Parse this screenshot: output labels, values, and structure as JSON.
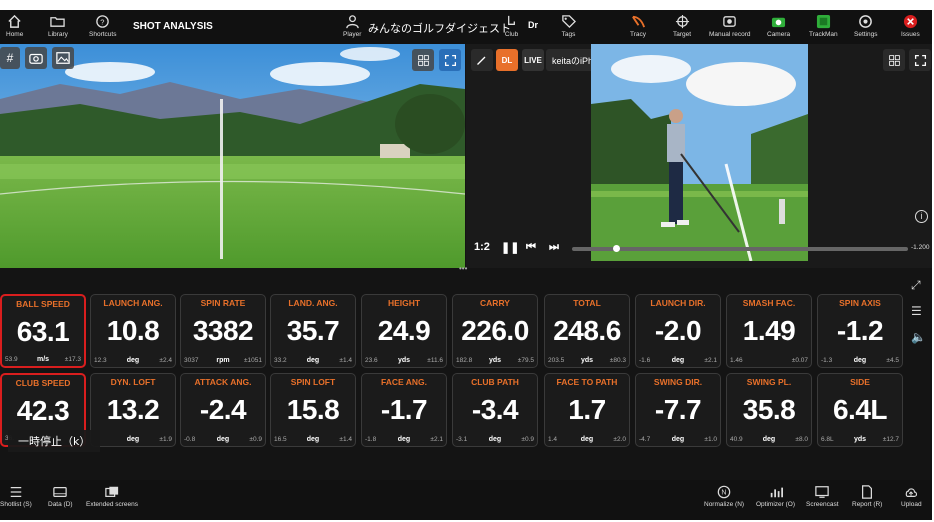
{
  "topbar": {
    "nav": [
      {
        "label": "Home",
        "icon": "home-icon"
      },
      {
        "label": "Library",
        "icon": "folder-icon"
      },
      {
        "label": "Shortcuts",
        "icon": "shortcuts-icon"
      }
    ],
    "title": "SHOT ANALYSIS",
    "player_label": "Player",
    "player_name": "みんなのゴルフダイジェスト",
    "club_label": "Club",
    "club_value": "Dr",
    "tags_label": "Tags",
    "right": [
      {
        "label": "Tracy",
        "icon": "tracy-icon"
      },
      {
        "label": "Target",
        "icon": "target-icon"
      },
      {
        "label": "Manual record",
        "icon": "manual-record-icon"
      },
      {
        "label": "Camera",
        "icon": "camera-icon"
      },
      {
        "label": "TrackMan",
        "icon": "trackman-icon"
      },
      {
        "label": "Settings",
        "icon": "settings-icon"
      },
      {
        "label": "Issues",
        "icon": "issues-icon"
      }
    ]
  },
  "video": {
    "dl_label": "DL",
    "live_label": "LIVE",
    "camera_name": "keitaのiPhone",
    "speed": "1:2",
    "time_end": "-1.200",
    "progress": 0.13
  },
  "metrics_row1": [
    {
      "label": "BALL SPEED",
      "value": "63.1",
      "min": "53.9",
      "unit": "m/s",
      "pm": "±17.3",
      "selected": true
    },
    {
      "label": "LAUNCH ANG.",
      "value": "10.8",
      "min": "12.3",
      "unit": "deg",
      "pm": "±2.4"
    },
    {
      "label": "SPIN RATE",
      "value": "3382",
      "min": "3037",
      "unit": "rpm",
      "pm": "±1051"
    },
    {
      "label": "LAND. ANG.",
      "value": "35.7",
      "min": "33.2",
      "unit": "deg",
      "pm": "±1.4"
    },
    {
      "label": "HEIGHT",
      "value": "24.9",
      "min": "23.6",
      "unit": "yds",
      "pm": "±11.6"
    },
    {
      "label": "CARRY",
      "value": "226.0",
      "min": "182.8",
      "unit": "yds",
      "pm": "±79.5"
    },
    {
      "label": "TOTAL",
      "value": "248.6",
      "min": "203.5",
      "unit": "yds",
      "pm": "±80.3"
    },
    {
      "label": "LAUNCH DIR.",
      "value": "-2.0",
      "min": "-1.6",
      "unit": "deg",
      "pm": "±2.1"
    },
    {
      "label": "SMASH FAC.",
      "value": "1.49",
      "min": "1.46",
      "unit": "",
      "pm": "±0.07"
    },
    {
      "label": "SPIN AXIS",
      "value": "-1.2",
      "min": "-1.3",
      "unit": "deg",
      "pm": "±4.5"
    }
  ],
  "metrics_row2": [
    {
      "label": "CLUB SPEED",
      "value": "42.3",
      "min": "36.",
      "unit": "",
      "pm": "",
      "selected": true
    },
    {
      "label": "DYN. LOFT",
      "value": "13.2",
      "min": "",
      "unit": "deg",
      "pm": "±1.9"
    },
    {
      "label": "ATTACK ANG.",
      "value": "-2.4",
      "min": "-0.8",
      "unit": "deg",
      "pm": "±0.9"
    },
    {
      "label": "SPIN LOFT",
      "value": "15.8",
      "min": "16.5",
      "unit": "deg",
      "pm": "±1.4"
    },
    {
      "label": "FACE ANG.",
      "value": "-1.7",
      "min": "-1.8",
      "unit": "deg",
      "pm": "±2.1"
    },
    {
      "label": "CLUB PATH",
      "value": "-3.4",
      "min": "-3.1",
      "unit": "deg",
      "pm": "±0.9"
    },
    {
      "label": "FACE TO PATH",
      "value": "1.7",
      "min": "1.4",
      "unit": "deg",
      "pm": "±2.0"
    },
    {
      "label": "SWING DIR.",
      "value": "-7.7",
      "min": "-4.7",
      "unit": "deg",
      "pm": "±1.0"
    },
    {
      "label": "SWING PL.",
      "value": "35.8",
      "min": "40.9",
      "unit": "deg",
      "pm": "±8.0"
    },
    {
      "label": "SIDE",
      "value": "6.4L",
      "min": "6.8L",
      "unit": "yds",
      "pm": "±12.7"
    }
  ],
  "tooltip": "一時停止（k）",
  "bottom": {
    "left": [
      {
        "label": "Shotlist (S)"
      },
      {
        "label": "Data (D)"
      },
      {
        "label": "Extended screens"
      }
    ],
    "right": [
      {
        "label": "Normalize (N)"
      },
      {
        "label": "Optimizer (O)"
      },
      {
        "label": "Screencast"
      },
      {
        "label": "Report (R)"
      },
      {
        "label": "Upload"
      }
    ]
  },
  "colors": {
    "accent": "#e8702a",
    "selected_border": "#d91e1e",
    "background": "#141414",
    "card": "#1b1b1b",
    "dl_button": "#e8702a"
  }
}
